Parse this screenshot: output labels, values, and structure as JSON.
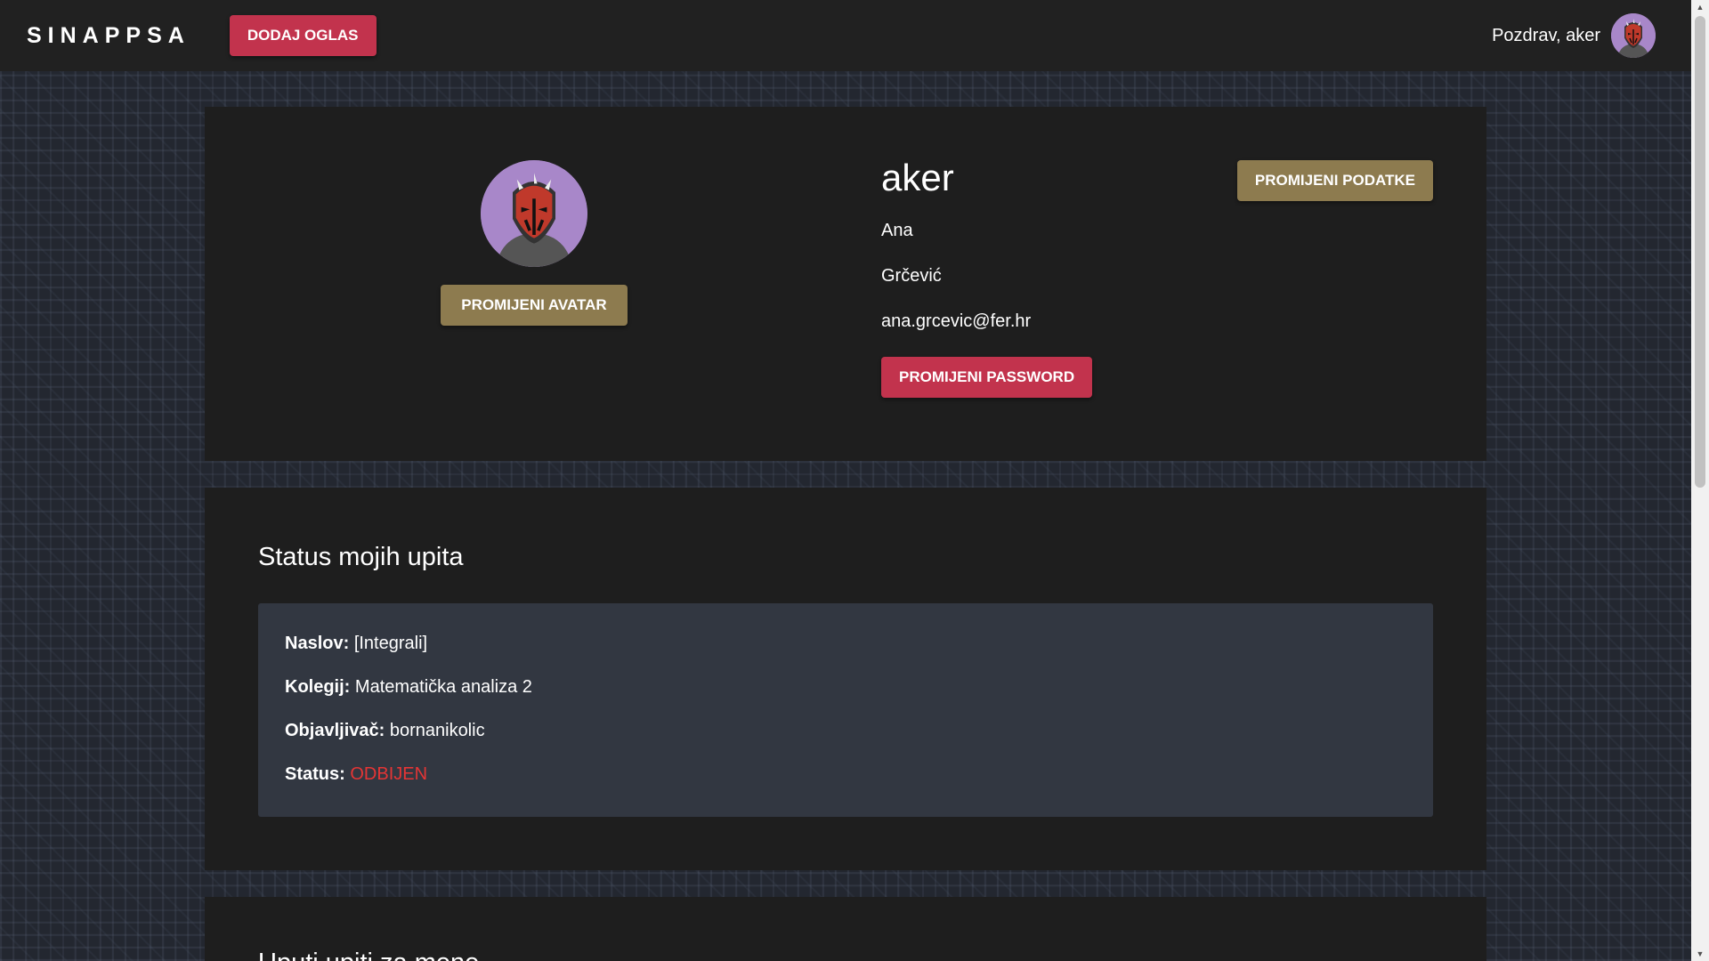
{
  "header": {
    "logo": "SINAPPSA",
    "add_button": "DODAJ OGLAS",
    "greeting": "Pozdrav, aker",
    "avatar_icon": "sith-mask-avatar"
  },
  "profile": {
    "username": "aker",
    "first_name": "Ana",
    "last_name": "Grčević",
    "email": "ana.grcevic@fer.hr",
    "change_avatar_label": "PROMIJENI AVATAR",
    "change_data_label": "PROMIJENI PODATKE",
    "change_password_label": "PROMIJENI PASSWORD"
  },
  "status_section": {
    "title": "Status mojih upita",
    "inquiries": [
      {
        "title_label": "Naslov:",
        "title_value": "[Integrali]",
        "course_label": "Kolegij:",
        "course_value": "Matematička analiza 2",
        "publisher_label": "Objavljivač:",
        "publisher_value": "bornanikolic",
        "status_label": "Status:",
        "status_value": "ODBIJEN"
      }
    ]
  },
  "third_section": {
    "title": "Uputi upiti za mene"
  },
  "colors": {
    "primary_red": "#c2334d",
    "gold": "#8d7b4f",
    "card_bg": "#1e1e1e",
    "inquiry_bg": "#323741",
    "status_rejected": "#e53535"
  }
}
